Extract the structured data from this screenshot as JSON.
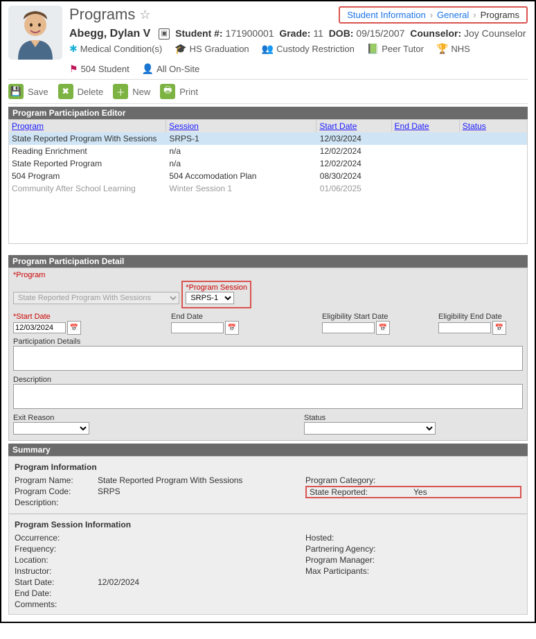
{
  "breadcrumb": {
    "a": "Student Information",
    "b": "General",
    "c": "Programs"
  },
  "header": {
    "title": "Programs",
    "name": "Abegg, Dylan V",
    "student_no_label": "Student #:",
    "student_no": "171900001",
    "grade_label": "Grade:",
    "grade": "11",
    "dob_label": "DOB:",
    "dob": "09/15/2007",
    "counselor_label": "Counselor:",
    "counselor": "Joy Counselor"
  },
  "flags": {
    "medical": "Medical Condition(s)",
    "grad": "HS Graduation",
    "custody": "Custody Restriction",
    "peer": "Peer Tutor",
    "nhs": "NHS",
    "f504": "504 Student",
    "onsite": "All On-Site"
  },
  "toolbar": {
    "save": "Save",
    "delete": "Delete",
    "new": "New",
    "print": "Print"
  },
  "editor": {
    "title": "Program Participation Editor",
    "cols": {
      "program": "Program",
      "session": "Session",
      "start": "Start Date",
      "end": "End Date",
      "status": "Status"
    },
    "rows": [
      {
        "p": "State Reported Program With Sessions",
        "s": "SRPS-1",
        "sd": "12/03/2024",
        "ed": "",
        "st": "",
        "sel": true
      },
      {
        "p": "Reading Enrichment",
        "s": "n/a",
        "sd": "12/02/2024",
        "ed": "",
        "st": ""
      },
      {
        "p": "State Reported Program",
        "s": "n/a",
        "sd": "12/02/2024",
        "ed": "",
        "st": ""
      },
      {
        "p": "504 Program",
        "s": "504 Accomodation Plan",
        "sd": "08/30/2024",
        "ed": "",
        "st": ""
      },
      {
        "p": "Community After School Learning",
        "s": "Winter Session 1",
        "sd": "01/06/2025",
        "ed": "",
        "st": "",
        "dis": true
      }
    ]
  },
  "detail": {
    "title": "Program Participation Detail",
    "program_label": "*Program",
    "program_value": "State Reported Program With Sessions",
    "session_label": "*Program Session",
    "session_value": "SRPS-1",
    "start_label": "*Start Date",
    "start_value": "12/03/2024",
    "end_label": "End Date",
    "end_value": "",
    "elig_start_label": "Eligibility Start Date",
    "elig_start_value": "",
    "elig_end_label": "Eligibility End Date",
    "elig_end_value": "",
    "participation_label": "Participation Details",
    "description_label": "Description",
    "exit_label": "Exit Reason",
    "status_label": "Status"
  },
  "summary": {
    "title": "Summary",
    "pi_title": "Program Information",
    "pname_l": "Program Name:",
    "pname_v": "State Reported Program With Sessions",
    "pcode_l": "Program Code:",
    "pcode_v": "SRPS",
    "pdesc_l": "Description:",
    "pdesc_v": "",
    "pcat_l": "Program Category:",
    "pcat_v": "",
    "srep_l": "State Reported:",
    "srep_v": "Yes",
    "psi_title": "Program Session Information",
    "occ_l": "Occurrence:",
    "occ_v": "",
    "freq_l": "Frequency:",
    "freq_v": "",
    "loc_l": "Location:",
    "loc_v": "",
    "inst_l": "Instructor:",
    "inst_v": "",
    "sd_l": "Start Date:",
    "sd_v": "12/02/2024",
    "ed_l": "End Date:",
    "ed_v": "",
    "com_l": "Comments:",
    "com_v": "",
    "host_l": "Hosted:",
    "host_v": "",
    "part_l": "Partnering Agency:",
    "part_v": "",
    "pmgr_l": "Program Manager:",
    "pmgr_v": "",
    "maxp_l": "Max Participants:",
    "maxp_v": ""
  }
}
